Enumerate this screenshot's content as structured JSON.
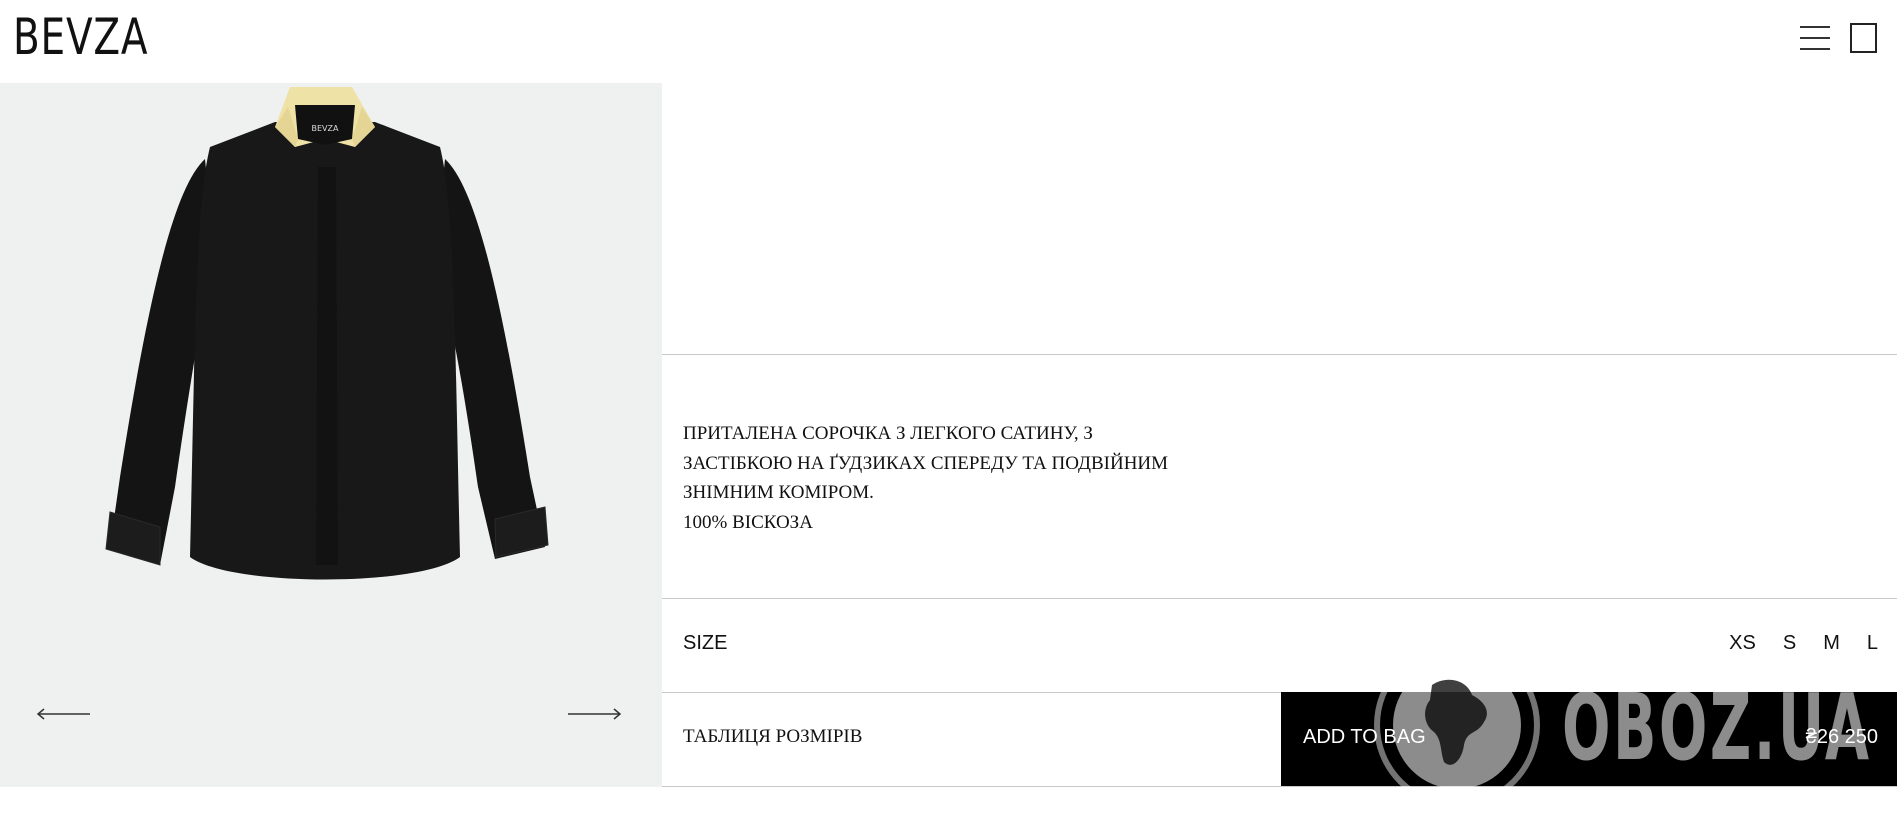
{
  "header": {
    "logo": "BEVZA"
  },
  "product": {
    "description_lines": [
      "ПРИТАЛЕНА СОРОЧКА З ЛЕГКОГО САТИНУ, З",
      "ЗАСТІБКОЮ НА ҐУДЗИКАХ СПЕРЕДУ ТА ПОДВІЙНИМ",
      "ЗНІМНИМ КОМІРОМ.",
      "100% ВІСКОЗА"
    ],
    "image_logo_text": "BEVZA",
    "size_label": "SIZE",
    "sizes": [
      "XS",
      "S",
      "M",
      "L"
    ],
    "size_table_label": "ТАБЛИЦЯ РОЗМІРІВ",
    "add_to_bag_label": "ADD TO BAG",
    "price": "₴26 250"
  },
  "watermark": {
    "text": "OBOZ.UA"
  },
  "icons": {
    "menu": "hamburger-menu-icon",
    "bag": "shopping-bag-icon",
    "prev": "arrow-left-icon",
    "next": "arrow-right-icon"
  },
  "colors": {
    "gallery_bg": "#eff1f0",
    "button_bg": "#000000",
    "collar": "#eee2a6"
  }
}
